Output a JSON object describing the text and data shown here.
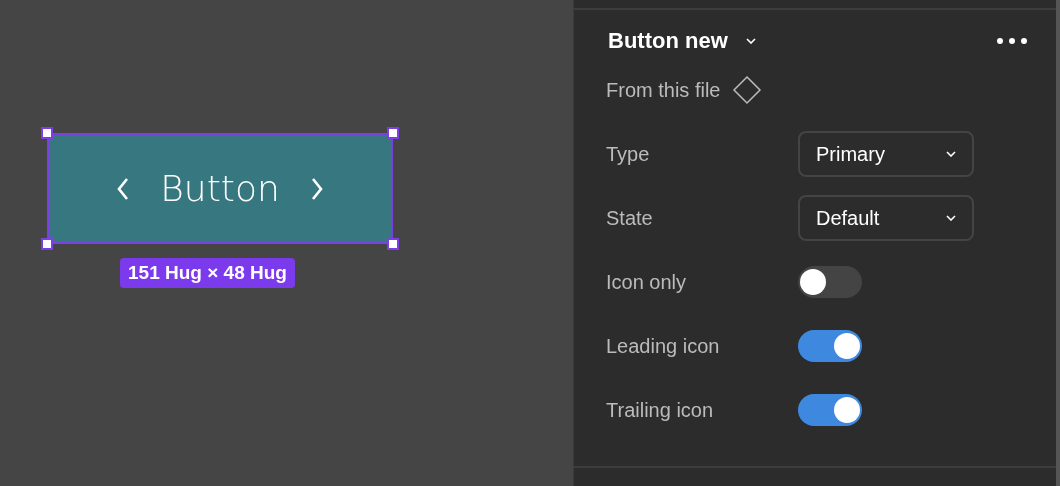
{
  "canvas": {
    "button": {
      "label": "Button"
    },
    "size_label": "151 Hug × 48 Hug"
  },
  "panel": {
    "title": "Button new",
    "source": "From this file",
    "properties": [
      {
        "kind": "select",
        "label": "Type",
        "value": "Primary"
      },
      {
        "kind": "select",
        "label": "State",
        "value": "Default"
      },
      {
        "kind": "toggle",
        "label": "Icon only",
        "on": false
      },
      {
        "kind": "toggle",
        "label": "Leading icon",
        "on": true
      },
      {
        "kind": "toggle",
        "label": "Trailing icon",
        "on": true
      }
    ]
  }
}
